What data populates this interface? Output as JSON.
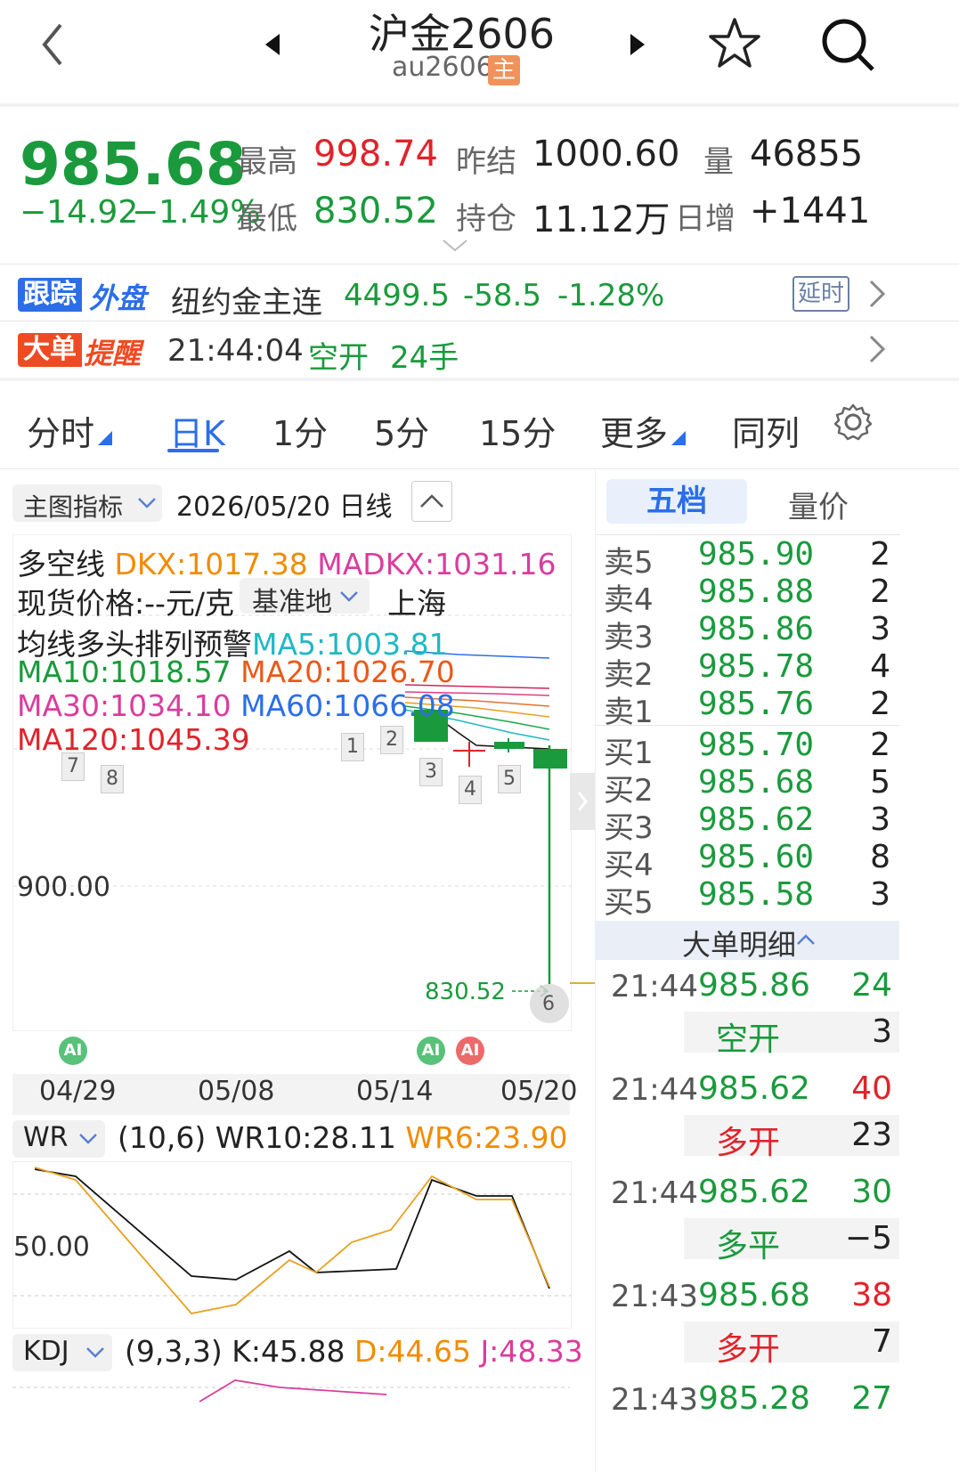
{
  "header": {
    "title": "沪金2606",
    "code": "au2606",
    "badge": "主"
  },
  "quote": {
    "last": "985.68",
    "change": "−14.92",
    "change_pct": "−1.49%",
    "high_label": "最高",
    "high": "998.74",
    "low_label": "最低",
    "low": "830.52",
    "prev_settle_label": "昨结",
    "prev_settle": "1000.60",
    "open_int_label": "持仓",
    "open_int": "11.12万",
    "volume_label": "量",
    "volume": "46855",
    "daily_inc_label": "日增",
    "daily_inc": "+1441"
  },
  "external": {
    "tag1": "跟踪",
    "tag2": "外盘",
    "name": "纽约金主连",
    "price": "4499.5",
    "change": "-58.5",
    "pct": "-1.28%",
    "delay": "延时"
  },
  "big_order": {
    "tag1": "大单",
    "tag2": "提醒",
    "time": "21:44:04",
    "type": "空开",
    "qty": "24手"
  },
  "tabs": [
    "分时",
    "日K",
    "1分",
    "5分",
    "15分",
    "更多",
    "同列"
  ],
  "chart_toolbar": {
    "indicator_label": "主图指标",
    "date_label": "2026/05/20 日线"
  },
  "indicators": {
    "dkx_title": "多空线",
    "dkx": "DKX:1017.38",
    "madkx": "MADKX:1031.16",
    "spot_label": "现货价格:--元/克",
    "base_label": "基准地",
    "base_city": "上海",
    "warn": "均线多头排列预警",
    "ma5": "MA5:1003.81",
    "ma10": "MA10:1018.57",
    "ma20": "MA20:1026.70",
    "ma30": "MA30:1034.10",
    "ma60": "MA60:1066.08",
    "ma120": "MA120:1045.39"
  },
  "price_axis": {
    "level_900": "900.00",
    "low_mark": "830.52"
  },
  "event_markers": [
    "1",
    "2",
    "3",
    "4",
    "5",
    "6",
    "7",
    "8"
  ],
  "ai_badge": "AI",
  "dates": [
    "04/29",
    "05/08",
    "05/14",
    "05/20"
  ],
  "wr": {
    "name": "WR",
    "params": "(10,6)",
    "wr10": "WR10:28.11",
    "wr6": "WR6:23.90",
    "level": "50.00"
  },
  "kdj": {
    "name": "KDJ",
    "params": "(9,3,3)",
    "k": "K:45.88",
    "d": "D:44.65",
    "j": "J:48.33"
  },
  "order_book": {
    "tab_active": "五档",
    "tab_other": "量价",
    "asks": [
      {
        "label": "卖5",
        "price": "985.90",
        "vol": "2"
      },
      {
        "label": "卖4",
        "price": "985.88",
        "vol": "2"
      },
      {
        "label": "卖3",
        "price": "985.86",
        "vol": "3"
      },
      {
        "label": "卖2",
        "price": "985.78",
        "vol": "4"
      },
      {
        "label": "卖1",
        "price": "985.76",
        "vol": "2"
      }
    ],
    "bids": [
      {
        "label": "买1",
        "price": "985.70",
        "vol": "2"
      },
      {
        "label": "买2",
        "price": "985.68",
        "vol": "5"
      },
      {
        "label": "买3",
        "price": "985.62",
        "vol": "3"
      },
      {
        "label": "买4",
        "price": "985.60",
        "vol": "8"
      },
      {
        "label": "买5",
        "price": "985.58",
        "vol": "3"
      }
    ]
  },
  "big_detail": {
    "title": "大单明细",
    "rows": [
      {
        "time": "21:44",
        "price": "985.86",
        "vol": "24",
        "vol_color": "green",
        "type": "空开",
        "type_color": "green",
        "sub": "3"
      },
      {
        "time": "21:44",
        "price": "985.62",
        "vol": "40",
        "vol_color": "red",
        "type": "多开",
        "type_color": "red",
        "sub": "23"
      },
      {
        "time": "21:44",
        "price": "985.62",
        "vol": "30",
        "vol_color": "green",
        "type": "多平",
        "type_color": "green",
        "sub": "−5"
      },
      {
        "time": "21:43",
        "price": "985.68",
        "vol": "38",
        "vol_color": "red",
        "type": "多开",
        "type_color": "red",
        "sub": "7"
      },
      {
        "time": "21:43",
        "price": "985.28",
        "vol": "27",
        "vol_color": "green",
        "type": "",
        "type_color": "green",
        "sub": ""
      }
    ]
  }
}
